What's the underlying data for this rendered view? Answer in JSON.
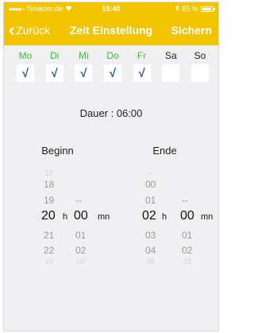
{
  "status": {
    "carrier": "Telekom.de",
    "time": "15:40",
    "battery": "85 %"
  },
  "nav": {
    "back_label": "Zurück",
    "title": "Zeit Einstellung",
    "save_label": "Sichern"
  },
  "days": [
    {
      "label": "Mo",
      "checked": true
    },
    {
      "label": "Di",
      "checked": true
    },
    {
      "label": "Mi",
      "checked": true
    },
    {
      "label": "Do",
      "checked": true
    },
    {
      "label": "Fr",
      "checked": true
    },
    {
      "label": "Sa",
      "checked": false
    },
    {
      "label": "So",
      "checked": false
    }
  ],
  "check_glyph": "√",
  "duration": {
    "label": "Dauer :",
    "value": "06:00"
  },
  "headers": {
    "begin": "Beginn",
    "end": "Ende"
  },
  "picker": {
    "begin_hours": [
      "17",
      "18",
      "19",
      "20",
      "21",
      "22",
      "23"
    ],
    "begin_minutes": [
      "--",
      "00",
      "01",
      "02",
      "03"
    ],
    "end_hours": [
      "--",
      "00",
      "01",
      "02",
      "03",
      "04",
      "05"
    ],
    "end_minutes": [
      "--",
      "00",
      "01",
      "02",
      "03"
    ],
    "hour_unit": "h",
    "minute_unit": "mn"
  },
  "colors": {
    "accent": "#f2c400",
    "active_day": "#3fbf3f",
    "check": "#1d4f8f"
  }
}
